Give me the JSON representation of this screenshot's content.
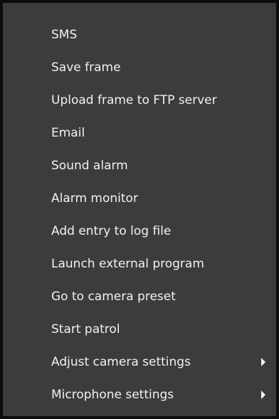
{
  "menu": {
    "items": [
      {
        "label": "SMS",
        "has_submenu": false
      },
      {
        "label": "Save frame",
        "has_submenu": false
      },
      {
        "label": "Upload frame to FTP server",
        "has_submenu": false
      },
      {
        "label": "Email",
        "has_submenu": false
      },
      {
        "label": "Sound alarm",
        "has_submenu": false
      },
      {
        "label": "Alarm monitor",
        "has_submenu": false
      },
      {
        "label": "Add entry to log file",
        "has_submenu": false
      },
      {
        "label": "Launch external program",
        "has_submenu": false
      },
      {
        "label": "Go to camera preset",
        "has_submenu": false
      },
      {
        "label": "Start patrol",
        "has_submenu": false
      },
      {
        "label": "Adjust camera settings",
        "has_submenu": true
      },
      {
        "label": "Microphone settings",
        "has_submenu": true
      }
    ],
    "submenu_icon": "chevron-right-icon",
    "colors": {
      "background": "#3c3c3c",
      "border": "#0c0c0c",
      "text": "#f2f2f2"
    }
  }
}
